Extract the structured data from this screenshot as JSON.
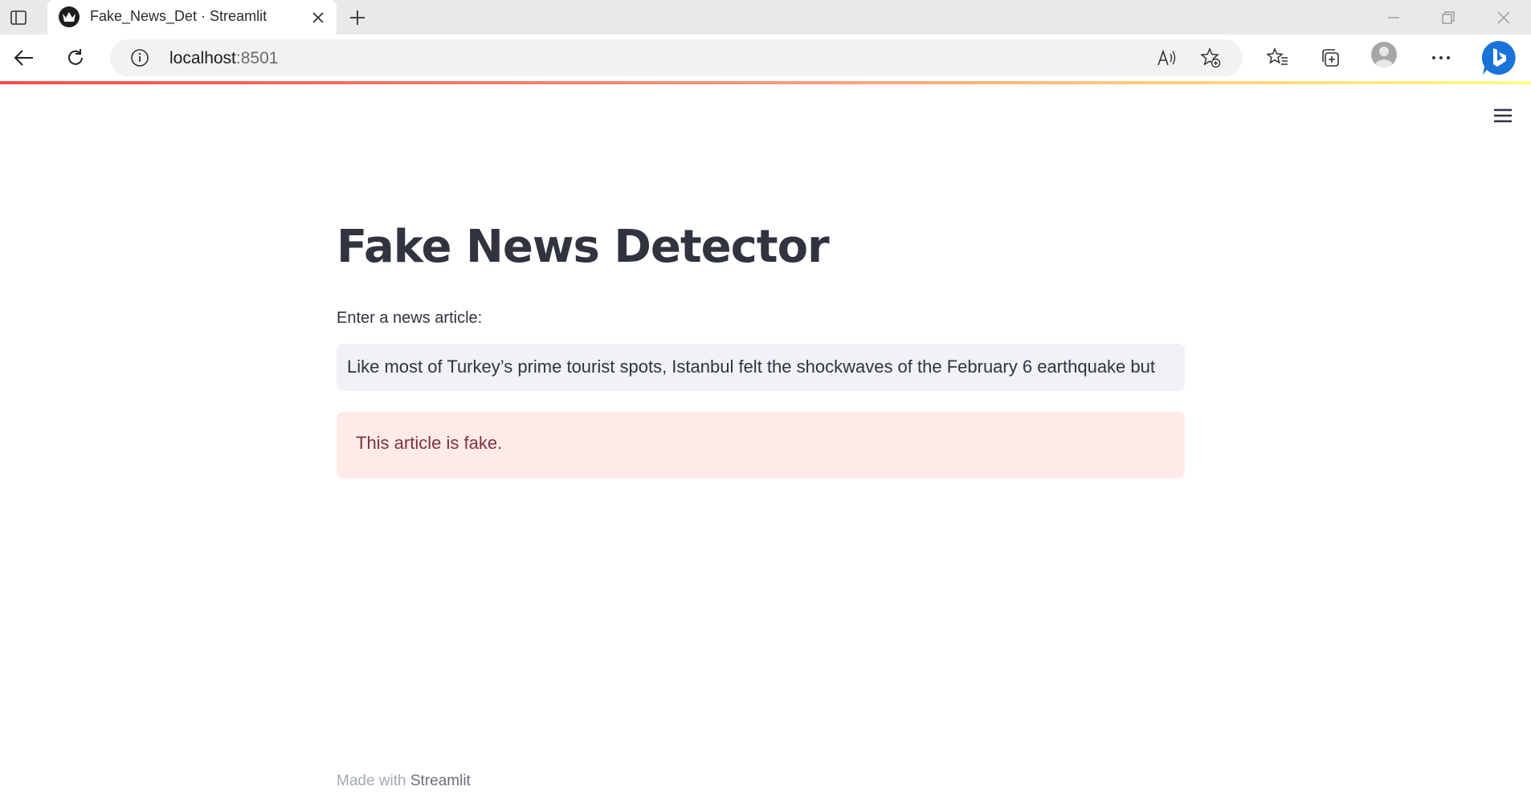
{
  "browser": {
    "tab": {
      "title": "Fake_News_Det · Streamlit",
      "favicon": "streamlit-crown-icon"
    },
    "address_bar": {
      "host": "localhost",
      "port": ":8501"
    },
    "icons": [
      "tab-actions-icon",
      "close-icon",
      "plus-icon",
      "minimize-icon",
      "restore-icon",
      "window-close-icon",
      "back-arrow-icon",
      "refresh-icon",
      "info-icon",
      "read-aloud-icon",
      "add-favorite-icon",
      "favorites-icon",
      "collections-icon",
      "profile-icon",
      "more-icon",
      "bing-icon"
    ]
  },
  "app": {
    "decoration_colors": [
      "#ff4b4b",
      "#fffd80"
    ],
    "title": "Fake News Detector",
    "input": {
      "label": "Enter a news article:",
      "value": "Like most of Turkey’s prime tourist spots, Istanbul felt the shockwaves of the February 6 earthquake but"
    },
    "result": {
      "message": "This article is fake.",
      "type": "error"
    },
    "footer": {
      "prefix": "Made with ",
      "link": "Streamlit"
    },
    "menu_icon": "hamburger-menu-icon"
  }
}
